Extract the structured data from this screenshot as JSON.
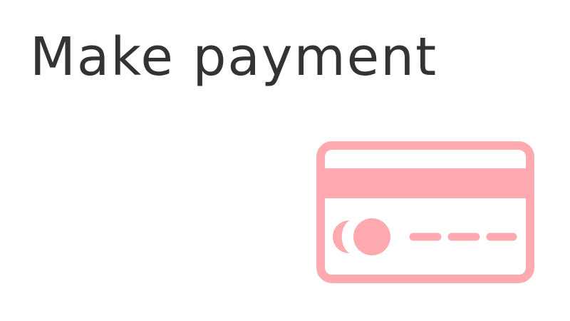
{
  "page": {
    "title": "Make payment"
  },
  "icon": {
    "name": "credit-card-icon",
    "color": "#ffaab1"
  }
}
